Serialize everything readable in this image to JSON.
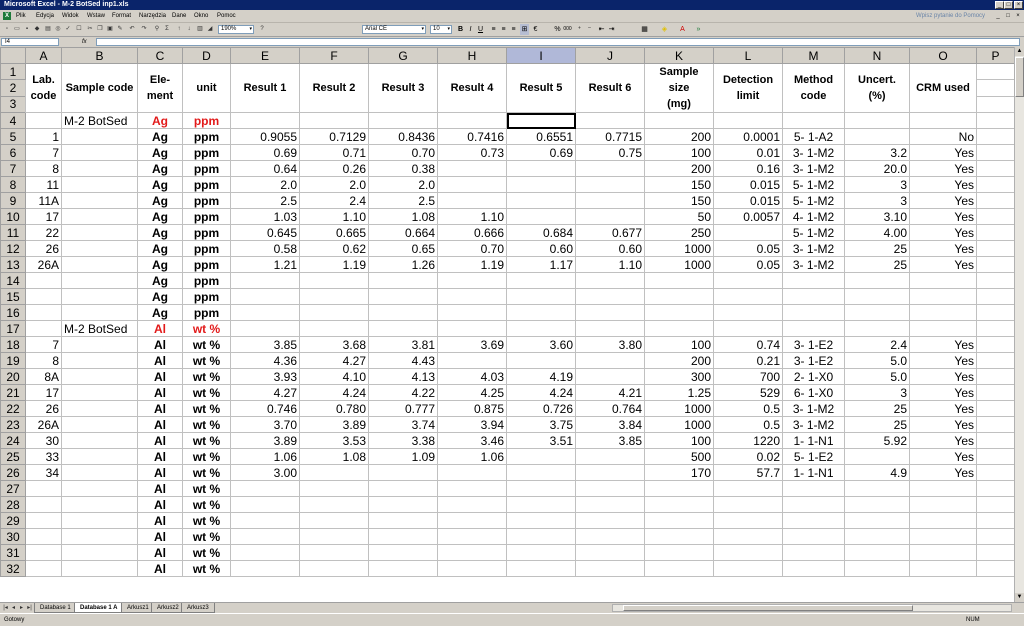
{
  "window": {
    "title": "Microsoft Excel - M-2 BotSed inp1.xls",
    "buttons": [
      "_",
      "□",
      "×"
    ]
  },
  "menu": {
    "items": [
      "Plik",
      "Edycja",
      "Widok",
      "Wstaw",
      "Format",
      "Narzędzia",
      "Dane",
      "Okno",
      "Pomoc"
    ],
    "help_placeholder": "Wpisz pytanie do Pomocy"
  },
  "toolbar": {
    "zoom": "190%",
    "font": "Arial CE",
    "size": "10",
    "bold": "B",
    "italic": "I",
    "underline": "U",
    "percent": "%",
    "thousands": "000"
  },
  "formula_bar": {
    "name_box": "I4",
    "fx": "fx",
    "content": ""
  },
  "grid": {
    "columns": [
      "A",
      "B",
      "C",
      "D",
      "E",
      "F",
      "G",
      "H",
      "I",
      "J",
      "K",
      "L",
      "M",
      "N",
      "O",
      "P"
    ],
    "selected_column": "I",
    "header_rows": {
      "row1": [
        "Lab.",
        "Sample code",
        "Ele-",
        "unit",
        "Result 1",
        "Result 2",
        "Result 3",
        "Result 4",
        "Result 5",
        "Result 6",
        "Sample",
        "Detection",
        "Method",
        "Uncert.",
        "CRM used"
      ],
      "row2": [
        "code",
        "",
        "ment",
        "",
        "",
        "",
        "",
        "",
        "",
        "",
        "size",
        "limit",
        "code",
        "(%)",
        ""
      ],
      "row3": [
        "",
        "",
        "",
        "",
        "",
        "",
        "",
        "",
        "",
        "",
        "(mg)",
        "",
        "",
        "",
        ""
      ]
    },
    "rows": [
      {
        "n": "4",
        "cells": [
          "",
          "M-2 BotSed",
          "Ag",
          "ppm",
          "",
          "",
          "",
          "",
          "",
          "",
          "",
          "",
          "",
          "",
          ""
        ],
        "section": true
      },
      {
        "n": "5",
        "cells": [
          "1",
          "",
          "Ag",
          "ppm",
          "0.9055",
          "0.7129",
          "0.8436",
          "0.7416",
          "0.6551",
          "0.7715",
          "200",
          "0.0001",
          "5- 1-A2",
          "",
          "No"
        ]
      },
      {
        "n": "6",
        "cells": [
          "7",
          "",
          "Ag",
          "ppm",
          "0.69",
          "0.71",
          "0.70",
          "0.73",
          "0.69",
          "0.75",
          "100",
          "0.01",
          "3- 1-M2",
          "3.2",
          "Yes"
        ]
      },
      {
        "n": "7",
        "cells": [
          "8",
          "",
          "Ag",
          "ppm",
          "0.64",
          "0.26",
          "0.38",
          "",
          "",
          "",
          "200",
          "0.16",
          "3- 1-M2",
          "20.0",
          "Yes"
        ]
      },
      {
        "n": "8",
        "cells": [
          "11",
          "",
          "Ag",
          "ppm",
          "2.0",
          "2.0",
          "2.0",
          "",
          "",
          "",
          "150",
          "0.015",
          "5- 1-M2",
          "3",
          "Yes"
        ]
      },
      {
        "n": "9",
        "cells": [
          "11A",
          "",
          "Ag",
          "ppm",
          "2.5",
          "2.4",
          "2.5",
          "",
          "",
          "",
          "150",
          "0.015",
          "5- 1-M2",
          "3",
          "Yes"
        ]
      },
      {
        "n": "10",
        "cells": [
          "17",
          "",
          "Ag",
          "ppm",
          "1.03",
          "1.10",
          "1.08",
          "1.10",
          "",
          "",
          "50",
          "0.0057",
          "4- 1-M2",
          "3.10",
          "Yes"
        ]
      },
      {
        "n": "11",
        "cells": [
          "22",
          "",
          "Ag",
          "ppm",
          "0.645",
          "0.665",
          "0.664",
          "0.666",
          "0.684",
          "0.677",
          "250",
          "",
          "5- 1-M2",
          "4.00",
          "Yes"
        ]
      },
      {
        "n": "12",
        "cells": [
          "26",
          "",
          "Ag",
          "ppm",
          "0.58",
          "0.62",
          "0.65",
          "0.70",
          "0.60",
          "0.60",
          "1000",
          "0.05",
          "3- 1-M2",
          "25",
          "Yes"
        ]
      },
      {
        "n": "13",
        "cells": [
          "26A",
          "",
          "Ag",
          "ppm",
          "1.21",
          "1.19",
          "1.26",
          "1.19",
          "1.17",
          "1.10",
          "1000",
          "0.05",
          "3- 1-M2",
          "25",
          "Yes"
        ]
      },
      {
        "n": "14",
        "cells": [
          "",
          "",
          "Ag",
          "ppm",
          "",
          "",
          "",
          "",
          "",
          "",
          "",
          "",
          "",
          "",
          ""
        ]
      },
      {
        "n": "15",
        "cells": [
          "",
          "",
          "Ag",
          "ppm",
          "",
          "",
          "",
          "",
          "",
          "",
          "",
          "",
          "",
          "",
          ""
        ]
      },
      {
        "n": "16",
        "cells": [
          "",
          "",
          "Ag",
          "ppm",
          "",
          "",
          "",
          "",
          "",
          "",
          "",
          "",
          "",
          "",
          ""
        ]
      },
      {
        "n": "17",
        "cells": [
          "",
          "M-2 BotSed",
          "Al",
          "wt %",
          "",
          "",
          "",
          "",
          "",
          "",
          "",
          "",
          "",
          "",
          ""
        ],
        "section": true
      },
      {
        "n": "18",
        "cells": [
          "7",
          "",
          "Al",
          "wt %",
          "3.85",
          "3.68",
          "3.81",
          "3.69",
          "3.60",
          "3.80",
          "100",
          "0.74",
          "3- 1-E2",
          "2.4",
          "Yes"
        ]
      },
      {
        "n": "19",
        "cells": [
          "8",
          "",
          "Al",
          "wt %",
          "4.36",
          "4.27",
          "4.43",
          "",
          "",
          "",
          "200",
          "0.21",
          "3- 1-E2",
          "5.0",
          "Yes"
        ]
      },
      {
        "n": "20",
        "cells": [
          "8A",
          "",
          "Al",
          "wt %",
          "3.93",
          "4.10",
          "4.13",
          "4.03",
          "4.19",
          "",
          "300",
          "700",
          "2- 1-X0",
          "5.0",
          "Yes"
        ]
      },
      {
        "n": "21",
        "cells": [
          "17",
          "",
          "Al",
          "wt %",
          "4.27",
          "4.24",
          "4.22",
          "4.25",
          "4.24",
          "4.21",
          "1.25",
          "529",
          "6- 1-X0",
          "3",
          "Yes"
        ]
      },
      {
        "n": "22",
        "cells": [
          "26",
          "",
          "Al",
          "wt %",
          "0.746",
          "0.780",
          "0.777",
          "0.875",
          "0.726",
          "0.764",
          "1000",
          "0.5",
          "3- 1-M2",
          "25",
          "Yes"
        ]
      },
      {
        "n": "23",
        "cells": [
          "26A",
          "",
          "Al",
          "wt %",
          "3.70",
          "3.89",
          "3.74",
          "3.94",
          "3.75",
          "3.84",
          "1000",
          "0.5",
          "3- 1-M2",
          "25",
          "Yes"
        ]
      },
      {
        "n": "24",
        "cells": [
          "30",
          "",
          "Al",
          "wt %",
          "3.89",
          "3.53",
          "3.38",
          "3.46",
          "3.51",
          "3.85",
          "100",
          "1220",
          "1- 1-N1",
          "5.92",
          "Yes"
        ]
      },
      {
        "n": "25",
        "cells": [
          "33",
          "",
          "Al",
          "wt %",
          "1.06",
          "1.08",
          "1.09",
          "1.06",
          "",
          "",
          "500",
          "0.02",
          "5- 1-E2",
          "",
          "Yes"
        ]
      },
      {
        "n": "26",
        "cells": [
          "34",
          "",
          "Al",
          "wt %",
          "3.00",
          "",
          "",
          "",
          "",
          "",
          "170",
          "57.7",
          "1- 1-N1",
          "4.9",
          "Yes"
        ]
      },
      {
        "n": "27",
        "cells": [
          "",
          "",
          "Al",
          "wt %",
          "",
          "",
          "",
          "",
          "",
          "",
          "",
          "",
          "",
          "",
          ""
        ]
      },
      {
        "n": "28",
        "cells": [
          "",
          "",
          "Al",
          "wt %",
          "",
          "",
          "",
          "",
          "",
          "",
          "",
          "",
          "",
          "",
          ""
        ]
      },
      {
        "n": "29",
        "cells": [
          "",
          "",
          "Al",
          "wt %",
          "",
          "",
          "",
          "",
          "",
          "",
          "",
          "",
          "",
          "",
          ""
        ]
      },
      {
        "n": "30",
        "cells": [
          "",
          "",
          "Al",
          "wt %",
          "",
          "",
          "",
          "",
          "",
          "",
          "",
          "",
          "",
          "",
          ""
        ]
      },
      {
        "n": "31",
        "cells": [
          "",
          "",
          "Al",
          "wt %",
          "",
          "",
          "",
          "",
          "",
          "",
          "",
          "",
          "",
          "",
          ""
        ]
      },
      {
        "n": "32",
        "cells": [
          "",
          "",
          "Al",
          "wt %",
          "",
          "",
          "",
          "",
          "",
          "",
          "",
          "",
          "",
          "",
          ""
        ]
      }
    ]
  },
  "sheet_tabs": {
    "tabs": [
      "Database 1",
      "Database 1 A",
      "Arkusz1",
      "Arkusz2",
      "Arkusz3"
    ],
    "active": "Database 1 A"
  },
  "status": {
    "text": "Gotowy",
    "num": "NUM"
  },
  "colors": {
    "title_bar": "#0a246a",
    "chrome": "#d4d0c8",
    "section_red": "#e21a1a"
  }
}
